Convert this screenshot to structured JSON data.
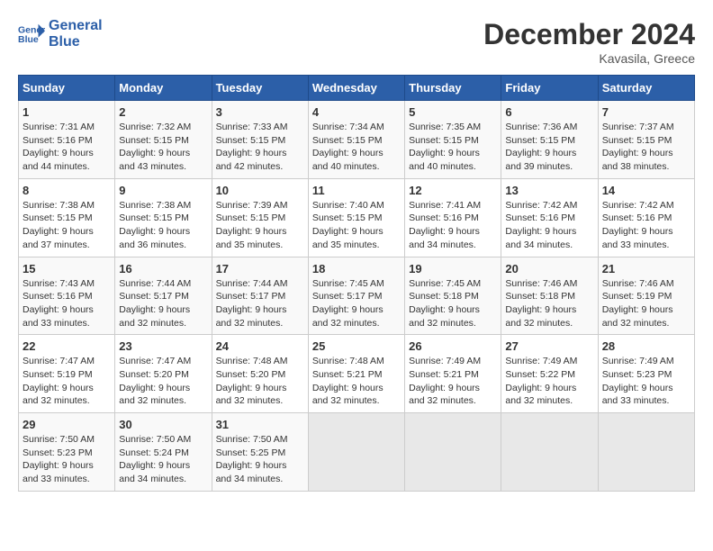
{
  "header": {
    "logo_line1": "General",
    "logo_line2": "Blue",
    "month": "December 2024",
    "location": "Kavasila, Greece"
  },
  "weekdays": [
    "Sunday",
    "Monday",
    "Tuesday",
    "Wednesday",
    "Thursday",
    "Friday",
    "Saturday"
  ],
  "weeks": [
    [
      {
        "day": "1",
        "sunrise": "7:31 AM",
        "sunset": "5:16 PM",
        "daylight": "9 hours and 44 minutes."
      },
      {
        "day": "2",
        "sunrise": "7:32 AM",
        "sunset": "5:15 PM",
        "daylight": "9 hours and 43 minutes."
      },
      {
        "day": "3",
        "sunrise": "7:33 AM",
        "sunset": "5:15 PM",
        "daylight": "9 hours and 42 minutes."
      },
      {
        "day": "4",
        "sunrise": "7:34 AM",
        "sunset": "5:15 PM",
        "daylight": "9 hours and 40 minutes."
      },
      {
        "day": "5",
        "sunrise": "7:35 AM",
        "sunset": "5:15 PM",
        "daylight": "9 hours and 40 minutes."
      },
      {
        "day": "6",
        "sunrise": "7:36 AM",
        "sunset": "5:15 PM",
        "daylight": "9 hours and 39 minutes."
      },
      {
        "day": "7",
        "sunrise": "7:37 AM",
        "sunset": "5:15 PM",
        "daylight": "9 hours and 38 minutes."
      }
    ],
    [
      {
        "day": "8",
        "sunrise": "7:38 AM",
        "sunset": "5:15 PM",
        "daylight": "9 hours and 37 minutes."
      },
      {
        "day": "9",
        "sunrise": "7:38 AM",
        "sunset": "5:15 PM",
        "daylight": "9 hours and 36 minutes."
      },
      {
        "day": "10",
        "sunrise": "7:39 AM",
        "sunset": "5:15 PM",
        "daylight": "9 hours and 35 minutes."
      },
      {
        "day": "11",
        "sunrise": "7:40 AM",
        "sunset": "5:15 PM",
        "daylight": "9 hours and 35 minutes."
      },
      {
        "day": "12",
        "sunrise": "7:41 AM",
        "sunset": "5:16 PM",
        "daylight": "9 hours and 34 minutes."
      },
      {
        "day": "13",
        "sunrise": "7:42 AM",
        "sunset": "5:16 PM",
        "daylight": "9 hours and 34 minutes."
      },
      {
        "day": "14",
        "sunrise": "7:42 AM",
        "sunset": "5:16 PM",
        "daylight": "9 hours and 33 minutes."
      }
    ],
    [
      {
        "day": "15",
        "sunrise": "7:43 AM",
        "sunset": "5:16 PM",
        "daylight": "9 hours and 33 minutes."
      },
      {
        "day": "16",
        "sunrise": "7:44 AM",
        "sunset": "5:17 PM",
        "daylight": "9 hours and 32 minutes."
      },
      {
        "day": "17",
        "sunrise": "7:44 AM",
        "sunset": "5:17 PM",
        "daylight": "9 hours and 32 minutes."
      },
      {
        "day": "18",
        "sunrise": "7:45 AM",
        "sunset": "5:17 PM",
        "daylight": "9 hours and 32 minutes."
      },
      {
        "day": "19",
        "sunrise": "7:45 AM",
        "sunset": "5:18 PM",
        "daylight": "9 hours and 32 minutes."
      },
      {
        "day": "20",
        "sunrise": "7:46 AM",
        "sunset": "5:18 PM",
        "daylight": "9 hours and 32 minutes."
      },
      {
        "day": "21",
        "sunrise": "7:46 AM",
        "sunset": "5:19 PM",
        "daylight": "9 hours and 32 minutes."
      }
    ],
    [
      {
        "day": "22",
        "sunrise": "7:47 AM",
        "sunset": "5:19 PM",
        "daylight": "9 hours and 32 minutes."
      },
      {
        "day": "23",
        "sunrise": "7:47 AM",
        "sunset": "5:20 PM",
        "daylight": "9 hours and 32 minutes."
      },
      {
        "day": "24",
        "sunrise": "7:48 AM",
        "sunset": "5:20 PM",
        "daylight": "9 hours and 32 minutes."
      },
      {
        "day": "25",
        "sunrise": "7:48 AM",
        "sunset": "5:21 PM",
        "daylight": "9 hours and 32 minutes."
      },
      {
        "day": "26",
        "sunrise": "7:49 AM",
        "sunset": "5:21 PM",
        "daylight": "9 hours and 32 minutes."
      },
      {
        "day": "27",
        "sunrise": "7:49 AM",
        "sunset": "5:22 PM",
        "daylight": "9 hours and 32 minutes."
      },
      {
        "day": "28",
        "sunrise": "7:49 AM",
        "sunset": "5:23 PM",
        "daylight": "9 hours and 33 minutes."
      }
    ],
    [
      {
        "day": "29",
        "sunrise": "7:50 AM",
        "sunset": "5:23 PM",
        "daylight": "9 hours and 33 minutes."
      },
      {
        "day": "30",
        "sunrise": "7:50 AM",
        "sunset": "5:24 PM",
        "daylight": "9 hours and 34 minutes."
      },
      {
        "day": "31",
        "sunrise": "7:50 AM",
        "sunset": "5:25 PM",
        "daylight": "9 hours and 34 minutes."
      },
      null,
      null,
      null,
      null
    ]
  ]
}
